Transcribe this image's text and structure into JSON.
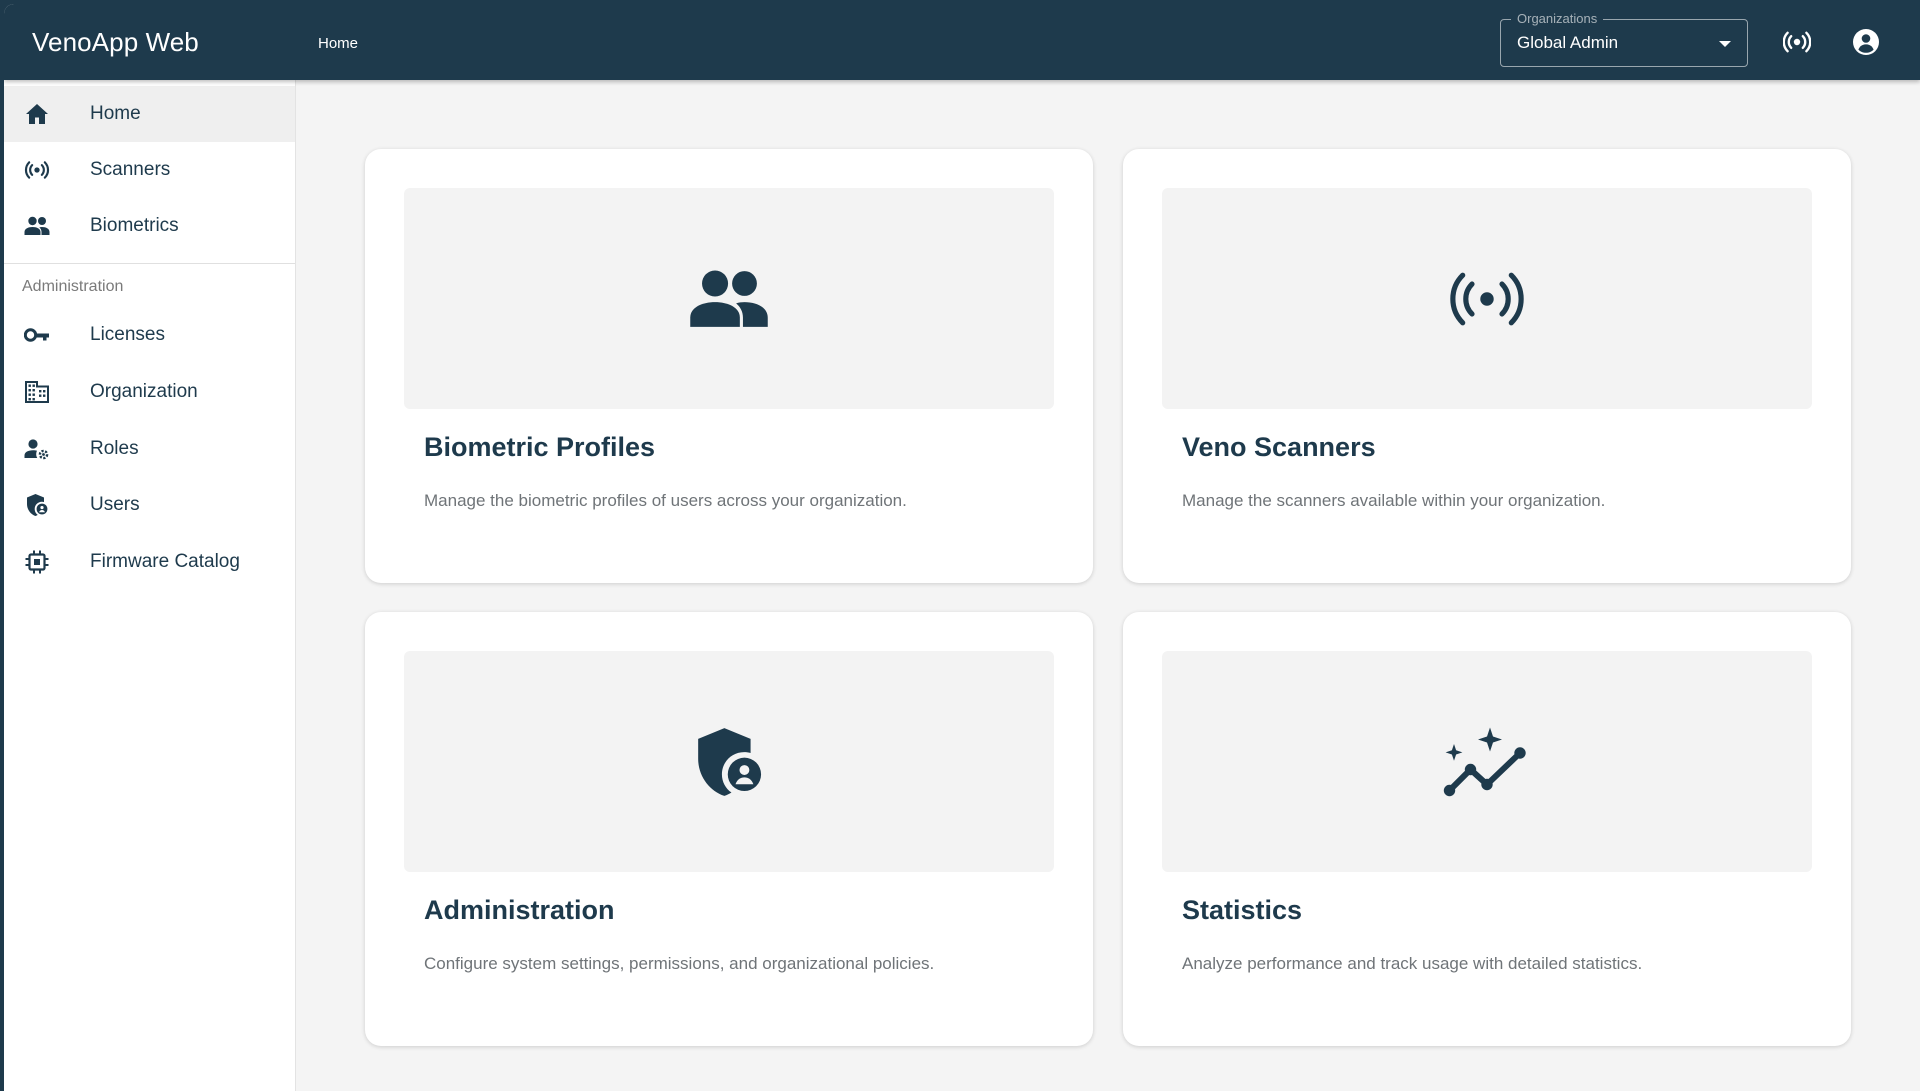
{
  "app": {
    "title": "VenoApp Web"
  },
  "topbar": {
    "breadcrumb": "Home",
    "organization_select": {
      "label": "Organizations",
      "value": "Global Admin"
    },
    "icons": [
      "sensors-icon",
      "account-circle-icon"
    ]
  },
  "sidebar": {
    "items": [
      {
        "label": "Home",
        "icon": "home-icon",
        "active": true
      },
      {
        "label": "Scanners",
        "icon": "sensors-icon"
      },
      {
        "label": "Biometrics",
        "icon": "people-icon"
      }
    ],
    "section_title": "Administration",
    "admin_items": [
      {
        "label": "Licenses",
        "icon": "key-icon"
      },
      {
        "label": "Organization",
        "icon": "building-icon"
      },
      {
        "label": "Roles",
        "icon": "person-gear-icon"
      },
      {
        "label": "Users",
        "icon": "admin-shield-icon"
      },
      {
        "label": "Firmware Catalog",
        "icon": "chip-icon"
      }
    ]
  },
  "cards": [
    {
      "title": "Biometric Profiles",
      "description": "Manage the biometric profiles of users across your organization.",
      "icon": "people-icon"
    },
    {
      "title": "Veno Scanners",
      "description": "Manage the scanners available within your organization.",
      "icon": "sensors-icon"
    },
    {
      "title": "Administration",
      "description": "Configure system settings, permissions, and organizational policies.",
      "icon": "admin-shield-icon"
    },
    {
      "title": "Statistics",
      "description": "Analyze performance and track usage with detailed statistics.",
      "icon": "insights-icon"
    }
  ],
  "colors": {
    "primary": "#1e3a4c",
    "background": "#f4f4f4",
    "card_media": "#f3f3f3",
    "description_text": "#6f7478"
  }
}
